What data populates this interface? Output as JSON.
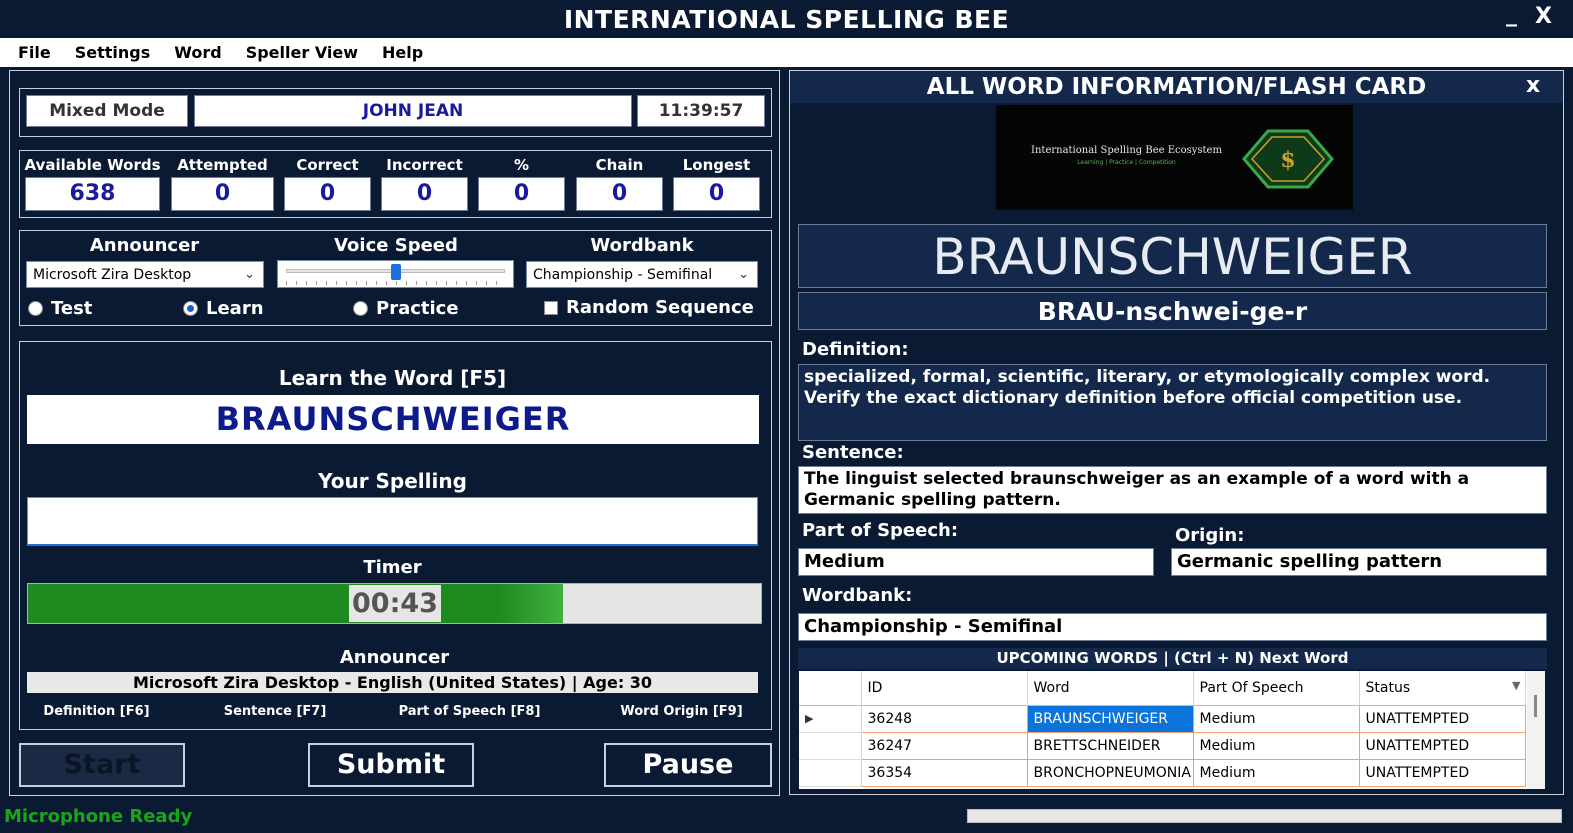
{
  "app": {
    "title": "INTERNATIONAL SPELLING BEE",
    "minimize": "_",
    "close": "X"
  },
  "menu": [
    "File",
    "Settings",
    "Word",
    "Speller View",
    "Help"
  ],
  "session": {
    "mode": "Mixed Mode",
    "user": "JOHN JEAN",
    "clock": "11:39:57"
  },
  "stats": [
    {
      "label": "Available Words",
      "value": "638"
    },
    {
      "label": "Attempted",
      "value": "0"
    },
    {
      "label": "Correct",
      "value": "0"
    },
    {
      "label": "Incorrect",
      "value": "0"
    },
    {
      "label": "%",
      "value": "0"
    },
    {
      "label": "Chain",
      "value": "0"
    },
    {
      "label": "Longest",
      "value": "0"
    }
  ],
  "settings": {
    "announcer_label": "Announcer",
    "announcer_value": "Microsoft Zira Desktop",
    "voice_speed_label": "Voice Speed",
    "voice_speed_fraction": 0.5,
    "wordbank_label": "Wordbank",
    "wordbank_value": "Championship - Semifinal",
    "modes": [
      {
        "label": "Test",
        "selected": false
      },
      {
        "label": "Learn",
        "selected": true
      },
      {
        "label": "Practice",
        "selected": false
      }
    ],
    "random_sequence_label": "Random Sequence",
    "random_sequence_checked": false
  },
  "learn": {
    "heading": "Learn the Word [F5]",
    "word": "BRAUNSCHWEIGER",
    "your_spelling_label": "Your Spelling",
    "your_spelling_value": "",
    "timer_label": "Timer",
    "timer_value": "00:43",
    "timer_fraction": 0.73,
    "announcer_label": "Announcer",
    "announcer_info": "Microsoft Zira Desktop - English (United States) | Age: 30",
    "hints": [
      "Definition [F6]",
      "Sentence [F7]",
      "Part of Speech [F8]",
      "Word Origin [F9]"
    ]
  },
  "buttons": {
    "start": "Start",
    "submit": "Submit",
    "pause": "Pause"
  },
  "status": {
    "microphone": "Microphone Ready"
  },
  "flash_card": {
    "title": "ALL WORD INFORMATION/FLASH CARD",
    "close": "x",
    "logo_text": "International Spelling Bee Ecosystem",
    "logo_sub": "Learning | Practice | Competition",
    "word": "BRAUNSCHWEIGER",
    "pronunciation": "BRAU-nschwei-ge-r",
    "definition_label": "Definition:",
    "definition": "specialized, formal, scientific, literary, or etymologically complex word. Verify the exact dictionary definition before official competition use.",
    "sentence_label": "Sentence:",
    "sentence": "The linguist selected braunschweiger as an example of a word with a Germanic spelling pattern.",
    "pos_label": "Part of Speech:",
    "pos": "Medium",
    "origin_label": "Origin:",
    "origin": "Germanic spelling pattern",
    "wordbank_label": "Wordbank:",
    "wordbank": "Championship - Semifinal",
    "upcoming_label": "UPCOMING WORDS | (Ctrl + N) Next Word",
    "columns": [
      "ID",
      "Word",
      "Part Of Speech",
      "Status"
    ],
    "rows": [
      {
        "id": "36248",
        "word": "BRAUNSCHWEIGER",
        "pos": "Medium",
        "status": "UNATTEMPTED"
      },
      {
        "id": "36247",
        "word": "BRETTSCHNEIDER",
        "pos": "Medium",
        "status": "UNATTEMPTED"
      },
      {
        "id": "36354",
        "word": "BRONCHOPNEUMONIA",
        "pos": "Medium",
        "status": "UNATTEMPTED"
      }
    ]
  },
  "colors": {
    "background": "#0b1a33",
    "timer_fill": "#1f8a1f",
    "status_green": "#1aa51a",
    "word_blue": "#0d1a8a",
    "selected_cell": "#0a74da"
  }
}
